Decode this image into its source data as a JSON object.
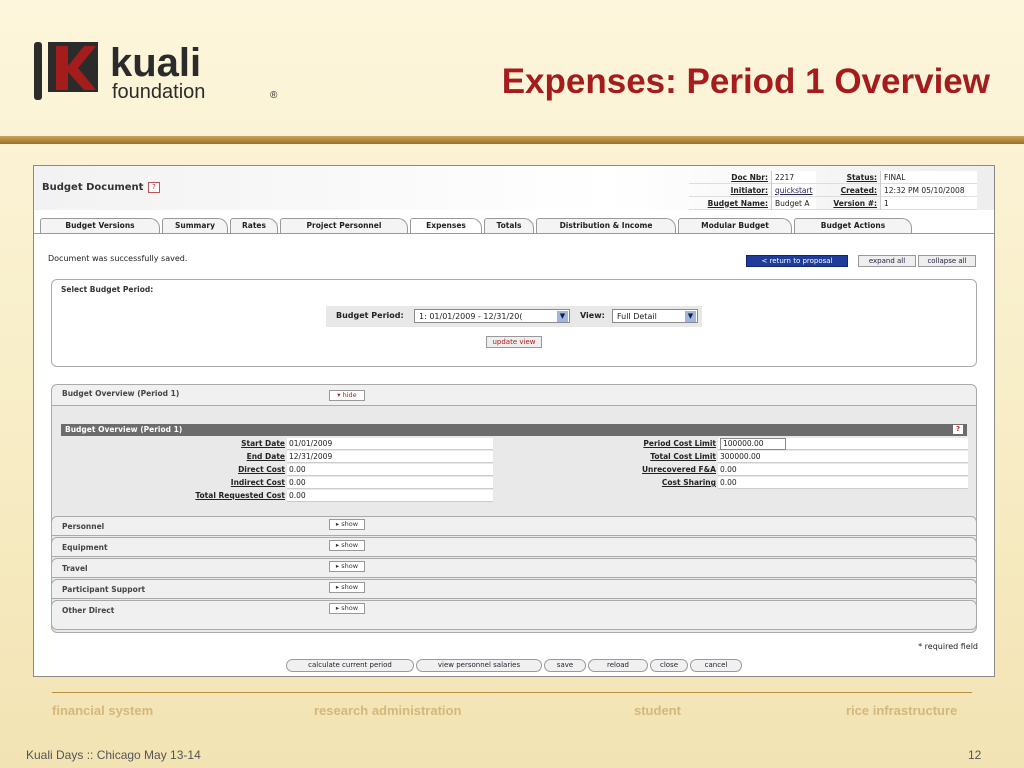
{
  "slide": {
    "logo_word": "kuali",
    "logo_sub": "foundation",
    "logo_mark": "®",
    "title": "Expenses: Period 1 Overview",
    "footer_left": "Kuali Days :: Chicago May 13-14",
    "page_number": "12",
    "footer_links": [
      "financial system",
      "research administration",
      "student",
      "rice infrastructure"
    ],
    "brand_color": "#a51c1c"
  },
  "doc": {
    "title": "Budget Document",
    "help_glyph": "?",
    "info": [
      {
        "label": "Doc Nbr:",
        "value": "2217",
        "label2": "Status:",
        "value2": "FINAL"
      },
      {
        "label": "Initiator:",
        "value": "quickstart",
        "label2": "Created:",
        "value2": "12:32 PM 05/10/2008"
      },
      {
        "label": "Budget Name:",
        "value": "Budget A",
        "label2": "Version #:",
        "value2": "1"
      }
    ]
  },
  "tabs": [
    "Budget Versions",
    "Summary",
    "Rates",
    "Project Personnel",
    "Expenses",
    "Totals",
    "Distribution & Income",
    "Modular Budget",
    "Budget Actions"
  ],
  "message": "Document was successfully saved.",
  "actions": {
    "return": "< return to proposal",
    "expand": "expand all",
    "collapse": "collapse all"
  },
  "period_panel": {
    "title": "Select Budget Period:",
    "period_label": "Budget Period:",
    "period_value": "1: 01/01/2009 - 12/31/20(",
    "view_label": "View:",
    "view_value": "Full Detail",
    "update": "update view"
  },
  "overview": {
    "tab_title": "Budget Overview (Period 1)",
    "hide": "▾ hide",
    "table_title": "Budget Overview (Period 1)",
    "left": [
      {
        "label": "Start Date",
        "value": "01/01/2009"
      },
      {
        "label": "End Date",
        "value": "12/31/2009"
      },
      {
        "label": "Direct Cost",
        "value": "0.00"
      },
      {
        "label": "Indirect Cost",
        "value": "0.00"
      },
      {
        "label": "Total Requested Cost",
        "value": "0.00"
      }
    ],
    "right": [
      {
        "label": "Period Cost Limit",
        "value": "100000.00"
      },
      {
        "label": "Total Cost Limit",
        "value": "300000.00"
      },
      {
        "label": "Unrecovered F&A",
        "value": "0.00"
      },
      {
        "label": "Cost Sharing",
        "value": "0.00"
      }
    ]
  },
  "sections": [
    "Personnel",
    "Equipment",
    "Travel",
    "Participant Support",
    "Other Direct"
  ],
  "show_label": "▸ show",
  "required_note": "* required field",
  "bottom_buttons": [
    "calculate current period",
    "view personnel salaries",
    "save",
    "reload",
    "close",
    "cancel"
  ]
}
